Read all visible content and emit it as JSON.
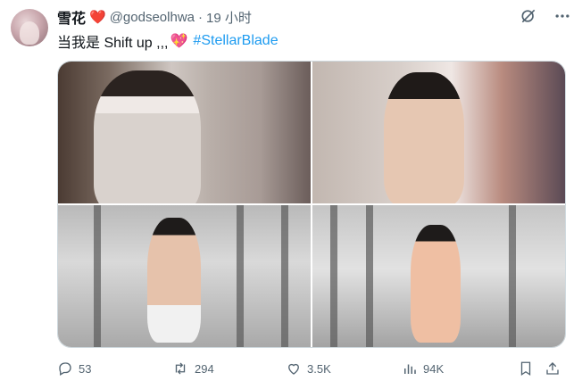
{
  "author": {
    "display_name": "雪花",
    "display_name_emoji": "❤️",
    "handle": "@godseolhwa",
    "separator": "·",
    "time_ago": "19 小时"
  },
  "tweet": {
    "text": "当我是 Shift up ,,,",
    "emoji": "💖",
    "hashtag": "#StellarBlade"
  },
  "media": {
    "photos": [
      {
        "alt": "photo-1"
      },
      {
        "alt": "photo-2"
      },
      {
        "alt": "photo-3"
      },
      {
        "alt": "photo-4"
      }
    ]
  },
  "actions": {
    "replies": "53",
    "retweets": "294",
    "likes": "3.5K",
    "views": "94K"
  },
  "icons": {
    "grok": "grok-icon",
    "more": "more-icon",
    "reply": "reply-icon",
    "retweet": "retweet-icon",
    "like": "heart-icon",
    "views": "views-icon",
    "bookmark": "bookmark-icon",
    "share": "share-icon"
  },
  "colors": {
    "text": "#0f1419",
    "muted": "#536471",
    "link": "#1d9bf0",
    "heart": "#e0245e"
  }
}
